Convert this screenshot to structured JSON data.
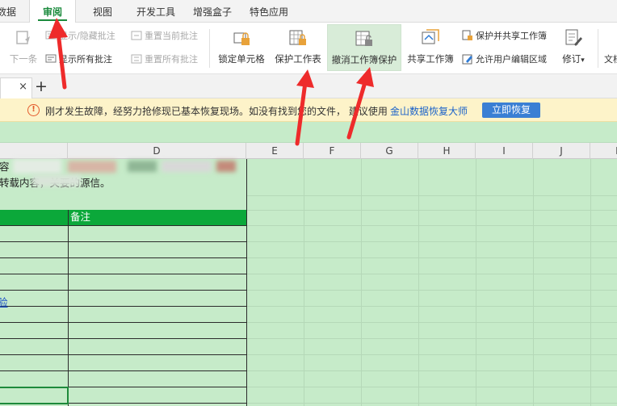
{
  "tabs": {
    "data_partial": "数据",
    "review": "审阅",
    "view": "视图",
    "developer": "开发工具",
    "enhance_box": "增强盒子",
    "special_apps": "特色应用"
  },
  "ribbon": {
    "next_item": "下一条",
    "show_hide_comment": "显示/隐藏批注",
    "show_all_comments": "显示所有批注",
    "reset_current_comment": "重置当前批注",
    "reset_all_comments": "重置所有批注",
    "lock_cell": "锁定单元格",
    "protect_sheet": "保护工作表",
    "unprotect_workbook": "撤消工作簿保护",
    "share_workbook": "共享工作簿",
    "protect_and_share": "保护并共享工作簿",
    "allow_edit_ranges": "允许用户编辑区域",
    "track_changes": "修订",
    "track_changes_arrow": "▾",
    "doc_partial": "文档"
  },
  "doc_tabs": {
    "close": "×",
    "add": "+"
  },
  "notice": {
    "icon": "!",
    "message": "刚才发生故障，经努力抢修现已基本恢复现场。如没有找到您的文件， 建议使用",
    "link": "金山数据恢复大师",
    "button": "立即恢复"
  },
  "columns": [
    "D",
    "E",
    "F",
    "G",
    "H",
    "I",
    "J",
    "K"
  ],
  "sheet": {
    "line1_partial": "容",
    "line2_partial": "转载内容，关要的源信。",
    "table_header_remark": "备注",
    "link_partial": "验"
  },
  "colors": {
    "accent_green": "#1a8a3c",
    "sheet_bg": "#c6ebc9",
    "header_green": "#0ba83a",
    "arrow_red": "#ee2b2b",
    "link_blue": "#1a62c9"
  }
}
